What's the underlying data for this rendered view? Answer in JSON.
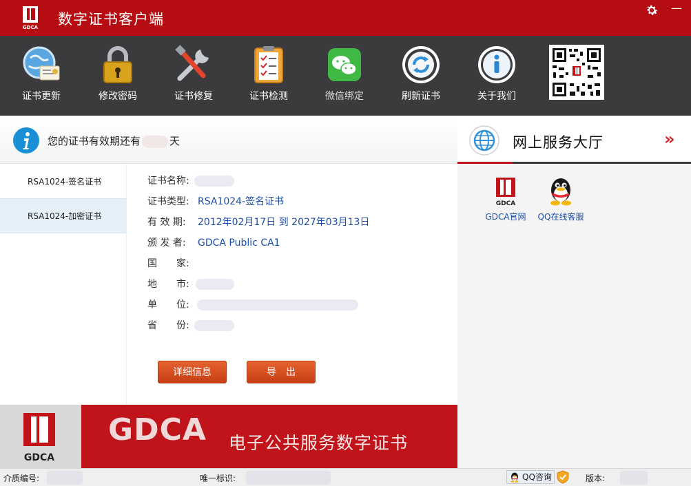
{
  "window": {
    "title": "数字证书客户端",
    "minimize_glyph": "—",
    "logo_text": "GDCA"
  },
  "toolbar": {
    "items": [
      {
        "label": "证书更新",
        "icon": "globe-certificate-icon"
      },
      {
        "label": "修改密码",
        "icon": "padlock-icon"
      },
      {
        "label": "证书修复",
        "icon": "tools-icon"
      },
      {
        "label": "证书检测",
        "icon": "clipboard-check-icon"
      },
      {
        "label": "微信绑定",
        "icon": "wechat-icon"
      },
      {
        "label": "刷新证书",
        "icon": "refresh-icon"
      },
      {
        "label": "关于我们",
        "icon": "info-icon"
      }
    ]
  },
  "validity": {
    "prefix": "您的证书有效期还有",
    "suffix": "天"
  },
  "cert_list": [
    "RSA1024-签名证书",
    "RSA1024-加密证书"
  ],
  "details": {
    "name_label": "证书名称:",
    "type_label": "证书类型:",
    "type_value": "RSA1024-签名证书",
    "validity_label": "有 效 期:",
    "validity_value": "2012年02月17日 到 2027年03月13日",
    "issuer_label": "颁 发 者:",
    "issuer_value": "GDCA Public CA1",
    "country_label": "国　　家:",
    "city_label": "地　　市:",
    "org_label": "单　　位:",
    "province_label": "省　　份:"
  },
  "buttons": {
    "details": "详细信息",
    "export": "导　出"
  },
  "banner": {
    "brand": "GDCA",
    "slogan": "电子公共服务数字证书",
    "logo_text": "GDCA"
  },
  "service_hall": {
    "title": "网上服务大厅",
    "arrows": "»",
    "items": [
      {
        "label": "GDCA官网",
        "icon": "gdca-logo-icon",
        "logo_text": "GDCA"
      },
      {
        "label": "QQ在线客服",
        "icon": "qq-penguin-icon"
      }
    ]
  },
  "status_bar": {
    "media_label": "介质编号:",
    "uid_label": "唯一标识:",
    "qq_label": "QQ咨询",
    "version_label": "版本:"
  },
  "colors": {
    "brand_red": "#b50d12",
    "toolbar_bg": "#3b3b3d",
    "link_blue": "#1c4da8",
    "button_orange": "#d8502a"
  }
}
